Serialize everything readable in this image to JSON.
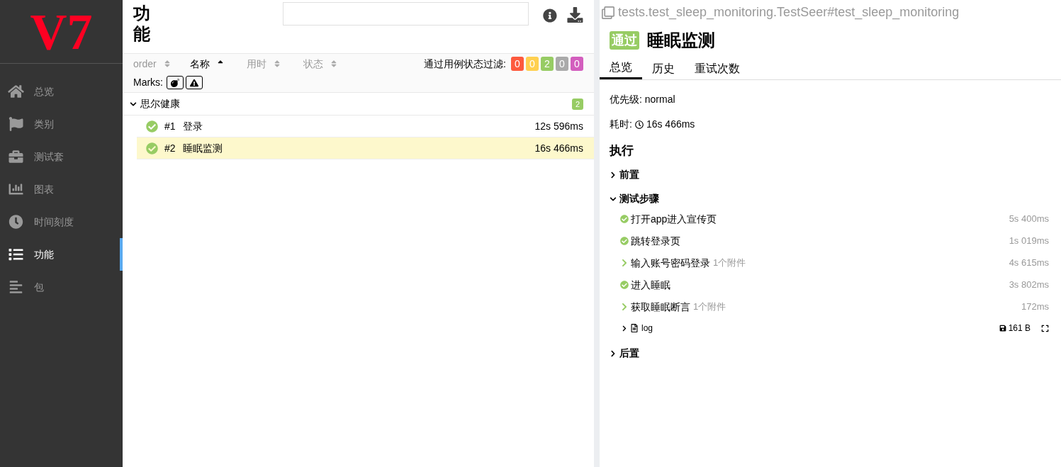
{
  "sidebar": {
    "logo": "V7",
    "items": [
      {
        "label": "总览",
        "selected": false
      },
      {
        "label": "类别",
        "selected": false
      },
      {
        "label": "测试套",
        "selected": false
      },
      {
        "label": "图表",
        "selected": false
      },
      {
        "label": "时间刻度",
        "selected": false
      },
      {
        "label": "功能",
        "selected": true
      },
      {
        "label": "包",
        "selected": false
      }
    ]
  },
  "list_pane": {
    "title": "功能",
    "sort_columns": [
      {
        "label": "order",
        "selected": false
      },
      {
        "label": "名称",
        "selected": true
      },
      {
        "label": "用时",
        "selected": false
      },
      {
        "label": "状态",
        "selected": false
      }
    ],
    "filter_label": "通过用例状态过滤:",
    "filters": [
      {
        "count": "0",
        "color": "#fd5a3e"
      },
      {
        "count": "0",
        "color": "#ffd050"
      },
      {
        "count": "2",
        "color": "#97cc64"
      },
      {
        "count": "0",
        "color": "#aaaaaa"
      },
      {
        "count": "0",
        "color": "#d35ebe"
      }
    ],
    "marks_label": "Marks:",
    "group": {
      "name": "思尔健康",
      "expanded": true,
      "count": "2",
      "tests": [
        {
          "number": "#1",
          "name": "登录",
          "duration": "12s 596ms",
          "selected": false
        },
        {
          "number": "#2",
          "name": "睡眠监测",
          "duration": "16s 466ms",
          "selected": true
        }
      ]
    }
  },
  "detail": {
    "full_name": "tests.test_sleep_monitoring.TestSeer#test_sleep_monitoring",
    "status": "通过",
    "title": "睡眠监测",
    "tabs": [
      {
        "label": "总览",
        "selected": true
      },
      {
        "label": "历史",
        "selected": false
      },
      {
        "label": "重试次数",
        "selected": false
      }
    ],
    "priority": "优先级: normal",
    "duration_label": "耗时:",
    "duration": "16s 466ms",
    "execution_title": "执行",
    "sections": [
      {
        "title": "前置",
        "expanded": false
      },
      {
        "title": "测试步骤",
        "expanded": true,
        "steps": [
          {
            "kind": "passed",
            "name": "打开app进入宣传页",
            "duration": "5s 400ms"
          },
          {
            "kind": "passed",
            "name": "跳转登录页",
            "duration": "1s 019ms"
          },
          {
            "kind": "expandable",
            "name": "输入账号密码登录",
            "attachments": "1个附件",
            "duration": "4s 615ms"
          },
          {
            "kind": "passed",
            "name": "进入睡眠",
            "duration": "3s 802ms"
          },
          {
            "kind": "expandable",
            "name": "获取睡眠断言",
            "attachments": "1个附件",
            "duration": "172ms"
          },
          {
            "kind": "attachment",
            "name": "log",
            "size": "161 B"
          }
        ]
      },
      {
        "title": "后置",
        "expanded": false
      }
    ]
  }
}
